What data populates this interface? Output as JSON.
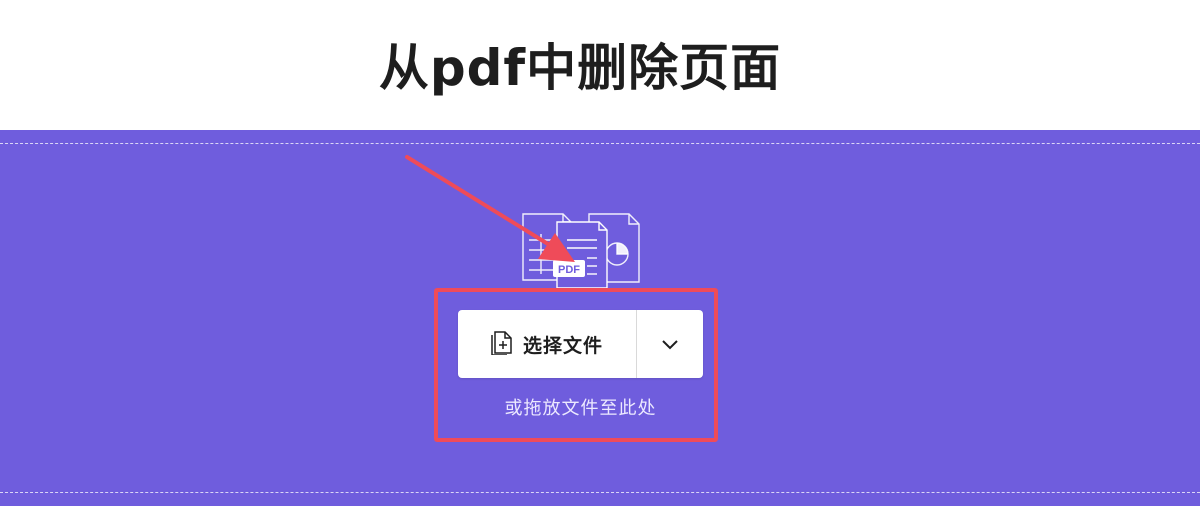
{
  "page": {
    "title": "从pdf中删除页面"
  },
  "upload": {
    "choose_file_label": "选择文件",
    "drop_hint": "或拖放文件至此处",
    "illustration_badge": "PDF"
  },
  "icons": {
    "file_icon": "file-plus-icon",
    "dropdown_icon": "chevron-down-icon"
  },
  "colors": {
    "drop_zone_bg": "#6f5ddd",
    "annotation": "#ef4b59",
    "title": "#1e1e1e"
  }
}
